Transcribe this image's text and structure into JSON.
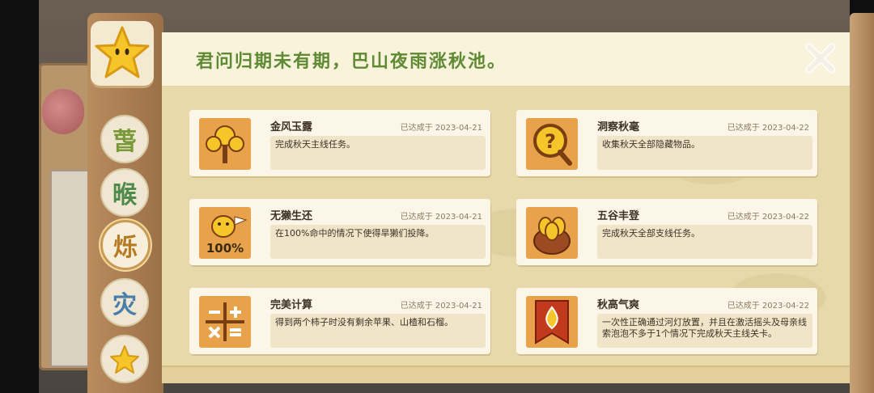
{
  "header": {
    "title": "君问归期未有期，巴山夜雨涨秋池。"
  },
  "tabs": [
    {
      "name": "star",
      "glyph": "★"
    },
    {
      "name": "spring",
      "glyph": "萅"
    },
    {
      "name": "summer",
      "glyph": "㬋"
    },
    {
      "name": "autumn",
      "glyph": "烁"
    },
    {
      "name": "winter",
      "glyph": "灾"
    },
    {
      "name": "special",
      "glyph": "✦"
    }
  ],
  "achievements": [
    {
      "name": "金风玉露",
      "date": "已达成于 2023-04-21",
      "desc": "完成秋天主线任务。",
      "icon": "golden-tree-icon"
    },
    {
      "name": "洞察秋毫",
      "date": "已达成于 2023-04-22",
      "desc": "收集秋天全部隐藏物品。",
      "icon": "magnifier-question-icon"
    },
    {
      "name": "无獭生还",
      "date": "已达成于 2023-04-21",
      "desc": "在100%命中的情况下使得旱獭们投降。",
      "icon": "otter-100-icon",
      "badge": "100%"
    },
    {
      "name": "五谷丰登",
      "date": "已达成于 2023-04-22",
      "desc": "完成秋天全部支线任务。",
      "icon": "grain-basket-icon"
    },
    {
      "name": "完美计算",
      "date": "已达成于 2023-04-21",
      "desc": "得到两个柿子时没有剩余苹果、山楂和石榴。",
      "icon": "math-symbols-icon"
    },
    {
      "name": "秋高气爽",
      "date": "已达成于 2023-04-22",
      "desc": "一次性正确通过河灯放置，并且在激活摇头及母亲线索泡泡不多于1个情况下完成秋天主线关卡。",
      "icon": "flame-banner-icon"
    }
  ],
  "colors": {
    "title": "#5e8a34",
    "icon_bg": "#e8a24a",
    "panel": "#f3e8c6"
  }
}
